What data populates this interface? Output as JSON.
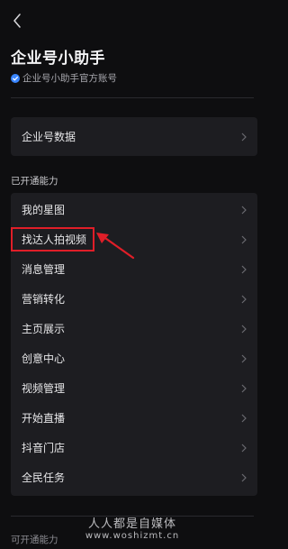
{
  "header": {
    "title": "企业号小助手",
    "subtitle": "企业号小助手官方账号",
    "verified_color": "#3a86ff"
  },
  "data_section": {
    "label": "企业号数据"
  },
  "enabled_section": {
    "label": "已开通能力",
    "items": [
      {
        "label": "我的星图"
      },
      {
        "label": "找达人拍视频"
      },
      {
        "label": "消息管理"
      },
      {
        "label": "营销转化"
      },
      {
        "label": "主页展示"
      },
      {
        "label": "创意中心"
      },
      {
        "label": "视频管理"
      },
      {
        "label": "开始直播"
      },
      {
        "label": "抖音门店"
      },
      {
        "label": "全民任务"
      }
    ]
  },
  "available_section": {
    "label": "可开通能力"
  },
  "annotation": {
    "highlight_color": "#e01e28"
  },
  "watermark": {
    "main": "人人都是自媒体",
    "url": "www.woshizmt.cn"
  }
}
